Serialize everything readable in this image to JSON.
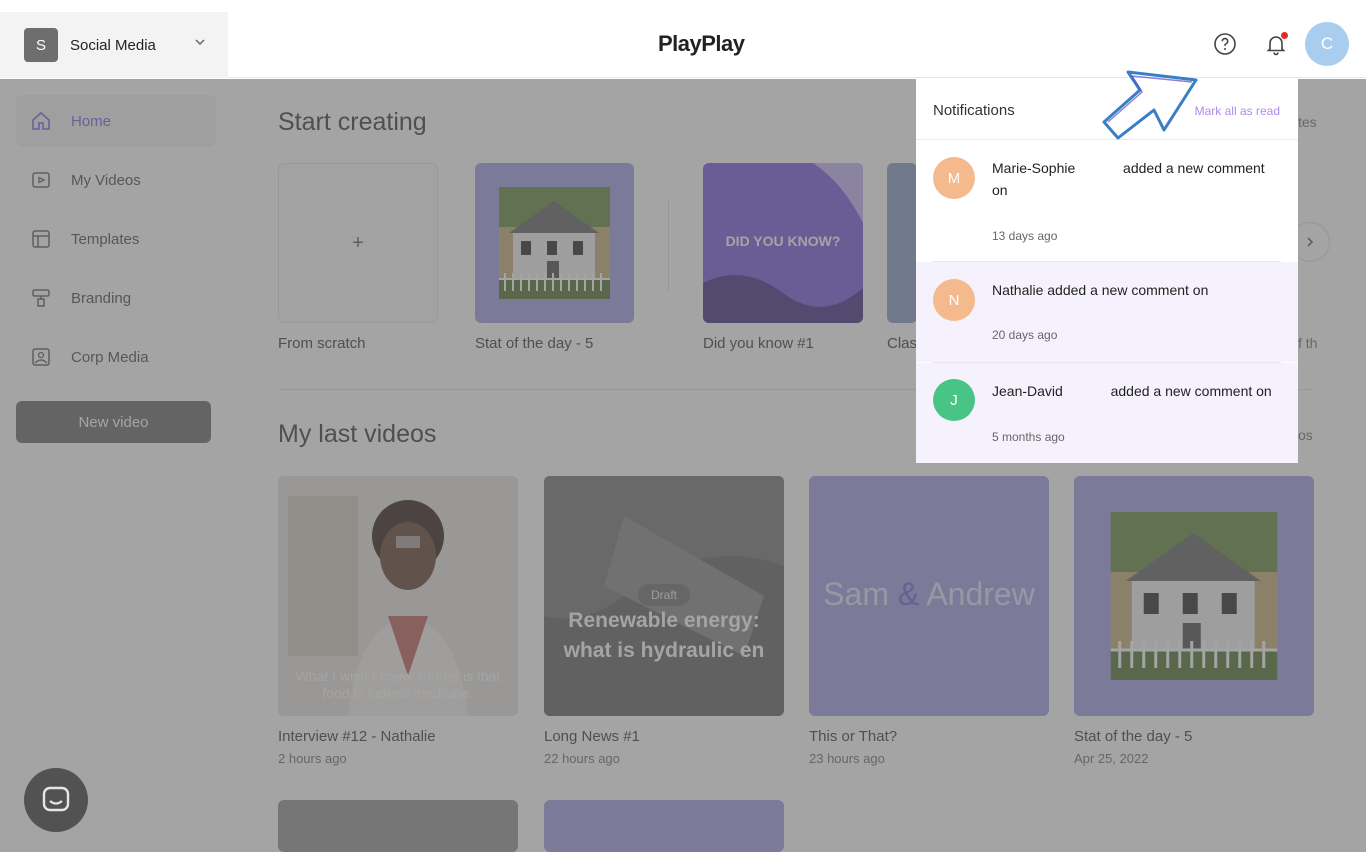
{
  "header": {
    "workspace_initial": "S",
    "workspace_name": "Social Media",
    "logo": "PlayPlay",
    "user_initial": "C",
    "icons": [
      "help-icon",
      "bell-icon"
    ]
  },
  "sidebar": {
    "items": [
      {
        "label": "Home",
        "icon": "home-icon",
        "active": true
      },
      {
        "label": "My Videos",
        "icon": "video-icon"
      },
      {
        "label": "Templates",
        "icon": "layout-icon"
      },
      {
        "label": "Branding",
        "icon": "paint-roller-icon"
      },
      {
        "label": "Corp Media",
        "icon": "image-icon"
      }
    ],
    "new_video": "New video"
  },
  "start_creating": {
    "title": "Start creating",
    "scratch_symbol": "+",
    "cards": [
      {
        "caption": "From scratch"
      },
      {
        "caption": "Stat of the day - 5"
      },
      {
        "caption": "Did you know #1",
        "overlay_text": "DID YOU KNOW?"
      },
      {
        "caption": "Clas"
      }
    ],
    "peek_right_top": "tes",
    "peek_right_mid": "f th"
  },
  "last_videos": {
    "title": "My last videos",
    "peek_right": "os",
    "items": [
      {
        "title": "Interview #12 - Nathalie",
        "time": "2 hours ago",
        "subtitle": "What I wish I knew sooner is that food is indeed medicine."
      },
      {
        "title": "Long News #1",
        "time": "22 hours ago",
        "badge": "Draft",
        "overlay": "Renewable energy: what is hydraulic en"
      },
      {
        "title": "This or That?",
        "time": "23 hours ago",
        "overlay_a": "Sam",
        "overlay_amp": "&",
        "overlay_b": "Andrew"
      },
      {
        "title": "Stat of the day - 5",
        "time": "Apr 25, 2022"
      }
    ]
  },
  "notifications": {
    "title": "Notifications",
    "mark_all": "Mark all as read",
    "items": [
      {
        "initial": "M",
        "name": "Marie-Sophie",
        "text": "added a new comment on",
        "time": "13 days ago",
        "color": "#f4b98c"
      },
      {
        "initial": "N",
        "name": "Nathalie",
        "text": "added a new comment on",
        "time": "20 days ago",
        "color": "#f4b98c"
      },
      {
        "initial": "J",
        "name": "Jean-David",
        "text": "added a new comment on",
        "time": "5 months ago",
        "color": "#48c487"
      }
    ]
  },
  "colors": {
    "accent": "#7b6cf0",
    "card_purple": "#a6a2e6",
    "unread_bg": "#f6f2fd"
  }
}
